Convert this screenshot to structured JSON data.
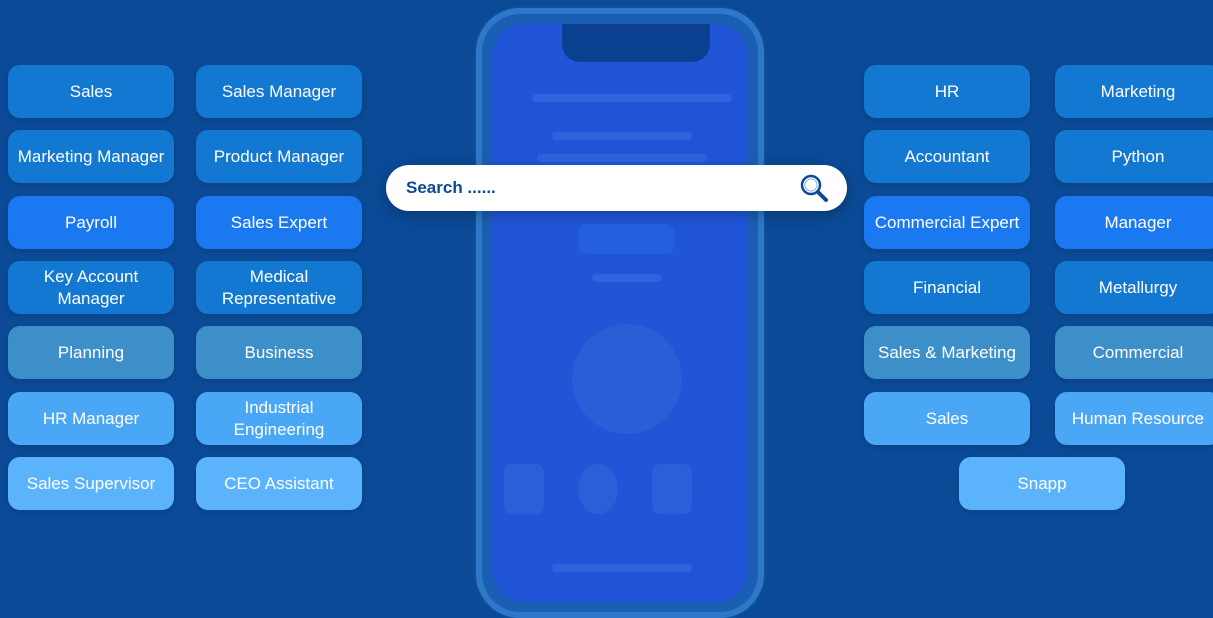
{
  "left_tags": [
    {
      "label": "Sales",
      "color": "mid"
    },
    {
      "label": "Sales Manager",
      "color": "mid"
    },
    {
      "label": "Marketing Manager",
      "color": "mid"
    },
    {
      "label": "Product Manager",
      "color": "mid"
    },
    {
      "label": "Payroll",
      "color": "bright"
    },
    {
      "label": "Sales Expert",
      "color": "bright"
    },
    {
      "label": "Key Account Manager",
      "color": "mid"
    },
    {
      "label": "Medical Representative",
      "color": "mid"
    },
    {
      "label": "Planning",
      "color": "dull"
    },
    {
      "label": "Business",
      "color": "dull"
    },
    {
      "label": "HR Manager",
      "color": "light"
    },
    {
      "label": "Industrial Engineering",
      "color": "light"
    },
    {
      "label": "Sales Supervisor",
      "color": "pale"
    },
    {
      "label": "CEO Assistant",
      "color": "pale"
    }
  ],
  "right_tags": [
    {
      "label": "HR",
      "color": "mid"
    },
    {
      "label": "Marketing",
      "color": "mid"
    },
    {
      "label": "Accountant",
      "color": "mid"
    },
    {
      "label": "Python",
      "color": "mid"
    },
    {
      "label": "Commercial Expert",
      "color": "bright"
    },
    {
      "label": "Manager",
      "color": "bright"
    },
    {
      "label": "Financial",
      "color": "mid"
    },
    {
      "label": "Metallurgy",
      "color": "mid"
    },
    {
      "label": "Sales & Marketing",
      "color": "dull"
    },
    {
      "label": "Commercial",
      "color": "dull"
    },
    {
      "label": "Sales",
      "color": "light"
    },
    {
      "label": "Human Resource",
      "color": "light"
    },
    {
      "label": "Snapp",
      "color": "pale"
    }
  ],
  "search": {
    "placeholder": "Search ......"
  },
  "icons": {
    "search": "search-icon"
  }
}
